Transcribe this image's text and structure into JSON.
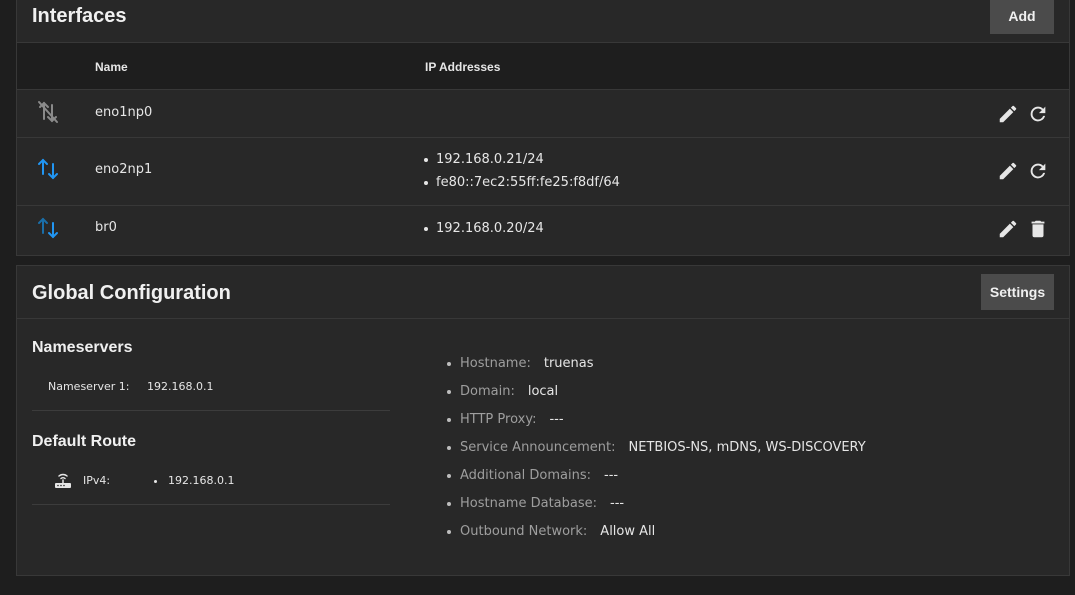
{
  "interfaces": {
    "title": "Interfaces",
    "add_label": "Add",
    "columns": {
      "name": "Name",
      "ip": "IP Addresses"
    },
    "rows": [
      {
        "name": "eno1np0",
        "status_icon": "link-disconnected-icon",
        "ips": [],
        "actions": [
          "edit-icon",
          "reset-icon"
        ]
      },
      {
        "name": "eno2np1",
        "status_icon": "link-up-down-arrows-icon",
        "ips": [
          "192.168.0.21/24",
          "fe80::7ec2:55ff:fe25:f8df/64"
        ],
        "actions": [
          "edit-icon",
          "reset-icon"
        ]
      },
      {
        "name": "br0",
        "status_icon": "link-up-down-arrows-icon",
        "ips": [
          "192.168.0.20/24"
        ],
        "actions": [
          "edit-icon",
          "delete-icon"
        ]
      }
    ]
  },
  "global": {
    "title": "Global Configuration",
    "settings_label": "Settings",
    "nameservers": {
      "title": "Nameservers",
      "items": [
        {
          "label": "Nameserver 1:",
          "value": "192.168.0.1"
        }
      ]
    },
    "default_route": {
      "title": "Default Route",
      "icon": "router-icon",
      "label": "IPv4:",
      "values": [
        "192.168.0.1"
      ]
    },
    "info": [
      {
        "label": "Hostname:",
        "value": "truenas"
      },
      {
        "label": "Domain:",
        "value": "local"
      },
      {
        "label": "HTTP Proxy:",
        "value": "---"
      },
      {
        "label": "Service Announcement:",
        "value": "NETBIOS-NS, mDNS, WS-DISCOVERY"
      },
      {
        "label": "Additional Domains:",
        "value": "---"
      },
      {
        "label": "Hostname Database:",
        "value": "---"
      },
      {
        "label": "Outbound Network:",
        "value": "Allow All"
      }
    ]
  },
  "colors": {
    "background": "#1e1e1e",
    "card": "#282828",
    "accent_blue": "#2196f3",
    "button": "#4b4b4b"
  }
}
